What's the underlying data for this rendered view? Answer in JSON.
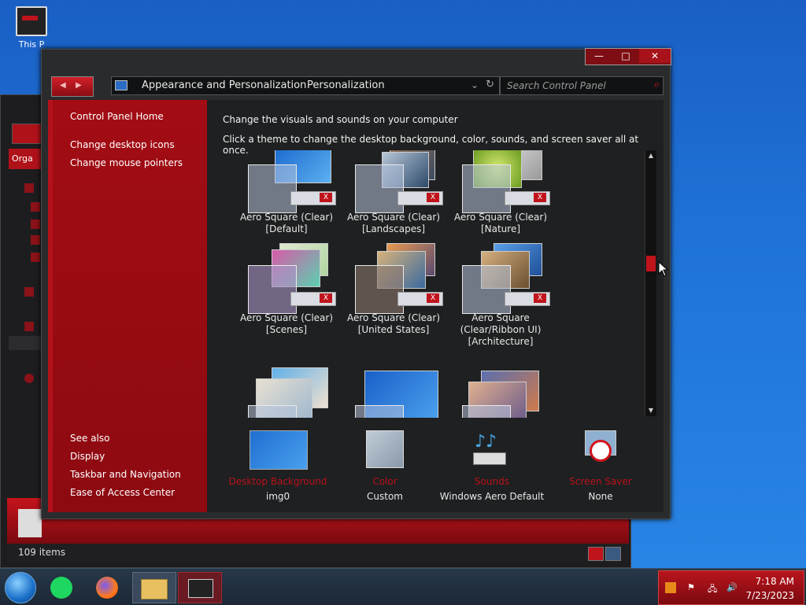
{
  "desktop": {
    "icon_label": "This P"
  },
  "background_window": {
    "organize_label": "Orga",
    "status_items": "109 items"
  },
  "window": {
    "title_buttons": {
      "minimize": "—",
      "maximize": "□",
      "close": "✕"
    },
    "address": {
      "crumbs": [
        "Appearance and Personalization",
        "Personalization"
      ]
    },
    "search": {
      "placeholder": "Search Control Panel"
    }
  },
  "left_pane": {
    "links": [
      "Control Panel Home",
      "Change desktop icons",
      "Change mouse pointers"
    ],
    "see_also_heading": "See also",
    "see_also": [
      "Display",
      "Taskbar and Navigation",
      "Ease of Access Center"
    ]
  },
  "content": {
    "title": "Change the visuals and sounds on your computer",
    "subtitle": "Click a theme to change the desktop background, color, sounds, and screen saver all at once.",
    "themes": [
      {
        "label": "Aero Square (Clear) [Default]",
        "line1": "Aero Square (Clear)",
        "line2": "[Default]",
        "colors": [
          "#2e7fd6",
          "#67b3f0"
        ]
      },
      {
        "label": "Aero Square (Clear) [Landscapes]",
        "line1": "Aero Square (Clear)",
        "line2": "[Landscapes]",
        "colors": [
          "#7d8fa8",
          "#2b3a52"
        ]
      },
      {
        "label": "Aero Square (Clear) [Nature]",
        "line1": "Aero Square (Clear)",
        "line2": "[Nature]",
        "colors": [
          "#9bc83a",
          "#d6e86a"
        ]
      },
      {
        "label": "Aero Square (Clear) [Scenes]",
        "line1": "Aero Square (Clear)",
        "line2": "[Scenes]",
        "colors": [
          "#c96aa8",
          "#8fd3c0"
        ]
      },
      {
        "label": "Aero Square (Clear) [United States]",
        "line1": "Aero Square (Clear)",
        "line2": "[United States]",
        "colors": [
          "#d98a3a",
          "#4a6fa8"
        ]
      },
      {
        "label": "Aero Square (Clear/Ribbon UI) [Architecture]",
        "line1": "Aero Square",
        "line2": "(Clear/Ribbon UI)",
        "line3": "[Architecture]",
        "colors": [
          "#3a78c8",
          "#d6a86a"
        ]
      },
      {
        "label": "",
        "colors": [
          "#6ab0e0",
          "#e8d6c0"
        ]
      },
      {
        "label": "",
        "colors": [
          "#1f6fd0",
          "#4aa0ee"
        ]
      },
      {
        "label": "",
        "colors": [
          "#5a6fb0",
          "#d07a4a"
        ]
      }
    ],
    "bottom": [
      {
        "name": "Desktop Background",
        "value": "img0",
        "icon": "desktop-background-icon"
      },
      {
        "name": "Color",
        "value": "Custom",
        "icon": "color-icon"
      },
      {
        "name": "Sounds",
        "value": "Windows Aero Default",
        "icon": "sounds-icon"
      },
      {
        "name": "Screen Saver",
        "value": "None",
        "icon": "screen-saver-icon"
      }
    ]
  },
  "taskbar": {
    "clock_time": "7:18 AM",
    "clock_date": "7/23/2023"
  },
  "colors": {
    "accent": "#c0141c",
    "window_bg": "#2a2b2d",
    "pane_red": "#a30c14"
  }
}
